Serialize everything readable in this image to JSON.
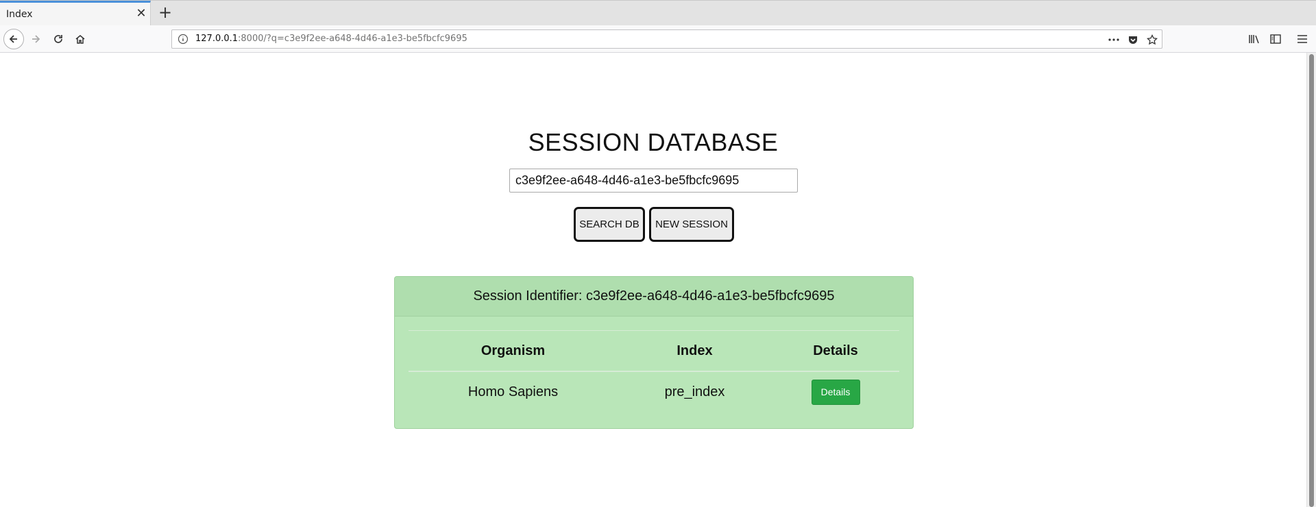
{
  "browser": {
    "tab_title": "Index",
    "url_host": "127.0.0.1",
    "url_rest": ":8000/?q=c3e9f2ee-a648-4d46-a1e3-be5fbcfc9695"
  },
  "page": {
    "heading": "SESSION DATABASE",
    "search_value": "c3e9f2ee-a648-4d46-a1e3-be5fbcfc9695",
    "search_button": "SEARCH DB",
    "new_session_button": "NEW SESSION"
  },
  "result": {
    "header": "Session Identifier: c3e9f2ee-a648-4d46-a1e3-be5fbcfc9695",
    "columns": [
      "Organism",
      "Index",
      "Details"
    ],
    "rows": [
      {
        "organism": "Homo Sapiens",
        "index": "pre_index",
        "details_label": "Details"
      }
    ]
  },
  "colors": {
    "card_bg": "#b9e6b8",
    "card_header_bg": "#afdeae",
    "details_button": "#28a745",
    "tab_accent": "#4a90d9"
  }
}
